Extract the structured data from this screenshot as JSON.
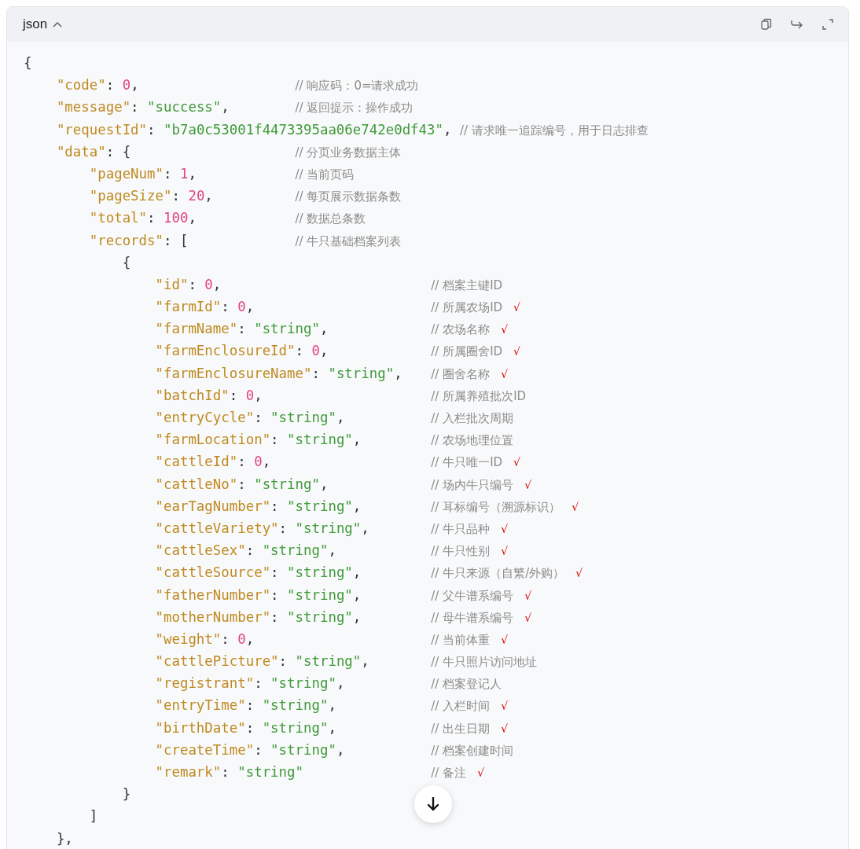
{
  "code_block": {
    "language": "json",
    "expanded": true,
    "lines": [
      {
        "tokens": [
          {
            "kind": "punct",
            "text": "{"
          }
        ],
        "children": [
          {
            "tokens": [
              {
                "kind": "key",
                "text": "\"code\""
              },
              {
                "kind": "punct",
                "text": ": "
              },
              {
                "kind": "number",
                "text": "0"
              },
              {
                "kind": "punct",
                "text": ","
              }
            ],
            "comment": "// 响应码：0=请求成功"
          },
          {
            "tokens": [
              {
                "kind": "key",
                "text": "\"message\""
              },
              {
                "kind": "punct",
                "text": ": "
              },
              {
                "kind": "string",
                "text": "\"success\""
              },
              {
                "kind": "punct",
                "text": ","
              }
            ],
            "comment": "// 返回提示：操作成功"
          },
          {
            "tokens": [
              {
                "kind": "key",
                "text": "\"requestId\""
              },
              {
                "kind": "punct",
                "text": ": "
              },
              {
                "kind": "string",
                "text": "\"b7a0c53001f4473395aa06e742e0df43\""
              },
              {
                "kind": "punct",
                "text": ","
              }
            ],
            "comment": "// 请求唯一追踪编号，用于日志排查"
          },
          {
            "tokens": [
              {
                "kind": "key",
                "text": "\"data\""
              },
              {
                "kind": "punct",
                "text": ": {"
              }
            ],
            "comment": "// 分页业务数据主体",
            "children": [
              {
                "tokens": [
                  {
                    "kind": "key",
                    "text": "\"pageNum\""
                  },
                  {
                    "kind": "punct",
                    "text": ": "
                  },
                  {
                    "kind": "number",
                    "text": "1"
                  },
                  {
                    "kind": "punct",
                    "text": ","
                  }
                ],
                "comment": "// 当前页码"
              },
              {
                "tokens": [
                  {
                    "kind": "key",
                    "text": "\"pageSize\""
                  },
                  {
                    "kind": "punct",
                    "text": ": "
                  },
                  {
                    "kind": "number",
                    "text": "20"
                  },
                  {
                    "kind": "punct",
                    "text": ","
                  }
                ],
                "comment": "// 每页展示数据条数"
              },
              {
                "tokens": [
                  {
                    "kind": "key",
                    "text": "\"total\""
                  },
                  {
                    "kind": "punct",
                    "text": ": "
                  },
                  {
                    "kind": "number",
                    "text": "100"
                  },
                  {
                    "kind": "punct",
                    "text": ","
                  }
                ],
                "comment": "// 数据总条数"
              },
              {
                "tokens": [
                  {
                    "kind": "key",
                    "text": "\"records\""
                  },
                  {
                    "kind": "punct",
                    "text": ": ["
                  }
                ],
                "comment": "// 牛只基础档案列表",
                "children": [
                  {
                    "tokens": [
                      {
                        "kind": "punct",
                        "text": "{"
                      }
                    ],
                    "children": [
                      {
                        "tokens": [
                          {
                            "kind": "key",
                            "text": "\"id\""
                          },
                          {
                            "kind": "punct",
                            "text": ": "
                          },
                          {
                            "kind": "number",
                            "text": "0"
                          },
                          {
                            "kind": "punct",
                            "text": ","
                          }
                        ],
                        "comment": "// 档案主键ID"
                      },
                      {
                        "tokens": [
                          {
                            "kind": "key",
                            "text": "\"farmId\""
                          },
                          {
                            "kind": "punct",
                            "text": ": "
                          },
                          {
                            "kind": "number",
                            "text": "0"
                          },
                          {
                            "kind": "punct",
                            "text": ","
                          }
                        ],
                        "comment": "// 所属农场ID",
                        "check": "√"
                      },
                      {
                        "tokens": [
                          {
                            "kind": "key",
                            "text": "\"farmName\""
                          },
                          {
                            "kind": "punct",
                            "text": ": "
                          },
                          {
                            "kind": "string",
                            "text": "\"string\""
                          },
                          {
                            "kind": "punct",
                            "text": ","
                          }
                        ],
                        "comment": "// 农场名称",
                        "check": "√"
                      },
                      {
                        "tokens": [
                          {
                            "kind": "key",
                            "text": "\"farmEnclosureId\""
                          },
                          {
                            "kind": "punct",
                            "text": ": "
                          },
                          {
                            "kind": "number",
                            "text": "0"
                          },
                          {
                            "kind": "punct",
                            "text": ","
                          }
                        ],
                        "comment": "// 所属圈舍ID",
                        "check": "√"
                      },
                      {
                        "tokens": [
                          {
                            "kind": "key",
                            "text": "\"farmEnclosureName\""
                          },
                          {
                            "kind": "punct",
                            "text": ": "
                          },
                          {
                            "kind": "string",
                            "text": "\"string\""
                          },
                          {
                            "kind": "punct",
                            "text": ","
                          }
                        ],
                        "comment": "// 圈舍名称",
                        "check": "√"
                      },
                      {
                        "tokens": [
                          {
                            "kind": "key",
                            "text": "\"batchId\""
                          },
                          {
                            "kind": "punct",
                            "text": ": "
                          },
                          {
                            "kind": "number",
                            "text": "0"
                          },
                          {
                            "kind": "punct",
                            "text": ","
                          }
                        ],
                        "comment": "// 所属养殖批次ID"
                      },
                      {
                        "tokens": [
                          {
                            "kind": "key",
                            "text": "\"entryCycle\""
                          },
                          {
                            "kind": "punct",
                            "text": ": "
                          },
                          {
                            "kind": "string",
                            "text": "\"string\""
                          },
                          {
                            "kind": "punct",
                            "text": ","
                          }
                        ],
                        "comment": "// 入栏批次周期"
                      },
                      {
                        "tokens": [
                          {
                            "kind": "key",
                            "text": "\"farmLocation\""
                          },
                          {
                            "kind": "punct",
                            "text": ": "
                          },
                          {
                            "kind": "string",
                            "text": "\"string\""
                          },
                          {
                            "kind": "punct",
                            "text": ","
                          }
                        ],
                        "comment": "// 农场地理位置"
                      },
                      {
                        "tokens": [
                          {
                            "kind": "key",
                            "text": "\"cattleId\""
                          },
                          {
                            "kind": "punct",
                            "text": ": "
                          },
                          {
                            "kind": "number",
                            "text": "0"
                          },
                          {
                            "kind": "punct",
                            "text": ","
                          }
                        ],
                        "comment": "// 牛只唯一ID",
                        "check": "√"
                      },
                      {
                        "tokens": [
                          {
                            "kind": "key",
                            "text": "\"cattleNo\""
                          },
                          {
                            "kind": "punct",
                            "text": ": "
                          },
                          {
                            "kind": "string",
                            "text": "\"string\""
                          },
                          {
                            "kind": "punct",
                            "text": ","
                          }
                        ],
                        "comment": "// 场内牛只编号",
                        "check": "√"
                      },
                      {
                        "tokens": [
                          {
                            "kind": "key",
                            "text": "\"earTagNumber\""
                          },
                          {
                            "kind": "punct",
                            "text": ": "
                          },
                          {
                            "kind": "string",
                            "text": "\"string\""
                          },
                          {
                            "kind": "punct",
                            "text": ","
                          }
                        ],
                        "comment": "// 耳标编号（溯源标识）",
                        "check": "√"
                      },
                      {
                        "tokens": [
                          {
                            "kind": "key",
                            "text": "\"cattleVariety\""
                          },
                          {
                            "kind": "punct",
                            "text": ": "
                          },
                          {
                            "kind": "string",
                            "text": "\"string\""
                          },
                          {
                            "kind": "punct",
                            "text": ","
                          }
                        ],
                        "comment": "// 牛只品种",
                        "check": "√"
                      },
                      {
                        "tokens": [
                          {
                            "kind": "key",
                            "text": "\"cattleSex\""
                          },
                          {
                            "kind": "punct",
                            "text": ": "
                          },
                          {
                            "kind": "string",
                            "text": "\"string\""
                          },
                          {
                            "kind": "punct",
                            "text": ","
                          }
                        ],
                        "comment": "// 牛只性别",
                        "check": "√"
                      },
                      {
                        "tokens": [
                          {
                            "kind": "key",
                            "text": "\"cattleSource\""
                          },
                          {
                            "kind": "punct",
                            "text": ": "
                          },
                          {
                            "kind": "string",
                            "text": "\"string\""
                          },
                          {
                            "kind": "punct",
                            "text": ","
                          }
                        ],
                        "comment": "// 牛只来源（自繁/外购）",
                        "check": "√"
                      },
                      {
                        "tokens": [
                          {
                            "kind": "key",
                            "text": "\"fatherNumber\""
                          },
                          {
                            "kind": "punct",
                            "text": ": "
                          },
                          {
                            "kind": "string",
                            "text": "\"string\""
                          },
                          {
                            "kind": "punct",
                            "text": ","
                          }
                        ],
                        "comment": "// 父牛谱系编号",
                        "check": "√"
                      },
                      {
                        "tokens": [
                          {
                            "kind": "key",
                            "text": "\"motherNumber\""
                          },
                          {
                            "kind": "punct",
                            "text": ": "
                          },
                          {
                            "kind": "string",
                            "text": "\"string\""
                          },
                          {
                            "kind": "punct",
                            "text": ","
                          }
                        ],
                        "comment": "// 母牛谱系编号",
                        "check": "√"
                      },
                      {
                        "tokens": [
                          {
                            "kind": "key",
                            "text": "\"weight\""
                          },
                          {
                            "kind": "punct",
                            "text": ": "
                          },
                          {
                            "kind": "number",
                            "text": "0"
                          },
                          {
                            "kind": "punct",
                            "text": ","
                          }
                        ],
                        "comment": "// 当前体重",
                        "check": "√"
                      },
                      {
                        "tokens": [
                          {
                            "kind": "key",
                            "text": "\"cattlePicture\""
                          },
                          {
                            "kind": "punct",
                            "text": ": "
                          },
                          {
                            "kind": "string",
                            "text": "\"string\""
                          },
                          {
                            "kind": "punct",
                            "text": ","
                          }
                        ],
                        "comment": "// 牛只照片访问地址"
                      },
                      {
                        "tokens": [
                          {
                            "kind": "key",
                            "text": "\"registrant\""
                          },
                          {
                            "kind": "punct",
                            "text": ": "
                          },
                          {
                            "kind": "string",
                            "text": "\"string\""
                          },
                          {
                            "kind": "punct",
                            "text": ","
                          }
                        ],
                        "comment": "// 档案登记人"
                      },
                      {
                        "tokens": [
                          {
                            "kind": "key",
                            "text": "\"entryTime\""
                          },
                          {
                            "kind": "punct",
                            "text": ": "
                          },
                          {
                            "kind": "string",
                            "text": "\"string\""
                          },
                          {
                            "kind": "punct",
                            "text": ","
                          }
                        ],
                        "comment": "// 入栏时间",
                        "check": "√"
                      },
                      {
                        "tokens": [
                          {
                            "kind": "key",
                            "text": "\"birthDate\""
                          },
                          {
                            "kind": "punct",
                            "text": ": "
                          },
                          {
                            "kind": "string",
                            "text": "\"string\""
                          },
                          {
                            "kind": "punct",
                            "text": ","
                          }
                        ],
                        "comment": "// 出生日期",
                        "check": "√"
                      },
                      {
                        "tokens": [
                          {
                            "kind": "key",
                            "text": "\"createTime\""
                          },
                          {
                            "kind": "punct",
                            "text": ": "
                          },
                          {
                            "kind": "string",
                            "text": "\"string\""
                          },
                          {
                            "kind": "punct",
                            "text": ","
                          }
                        ],
                        "comment": "// 档案创建时间"
                      },
                      {
                        "tokens": [
                          {
                            "kind": "key",
                            "text": "\"remark\""
                          },
                          {
                            "kind": "punct",
                            "text": ": "
                          },
                          {
                            "kind": "string",
                            "text": "\"string\""
                          }
                        ],
                        "comment": "// 备注",
                        "check": "√"
                      }
                    ]
                  },
                  {
                    "tokens": [
                      {
                        "kind": "punct",
                        "text": "}"
                      }
                    ]
                  }
                ]
              },
              {
                "tokens": [
                  {
                    "kind": "punct",
                    "text": "]"
                  }
                ]
              }
            ]
          },
          {
            "tokens": [
              {
                "kind": "punct",
                "text": "},"
              }
            ]
          }
        ]
      }
    ]
  }
}
